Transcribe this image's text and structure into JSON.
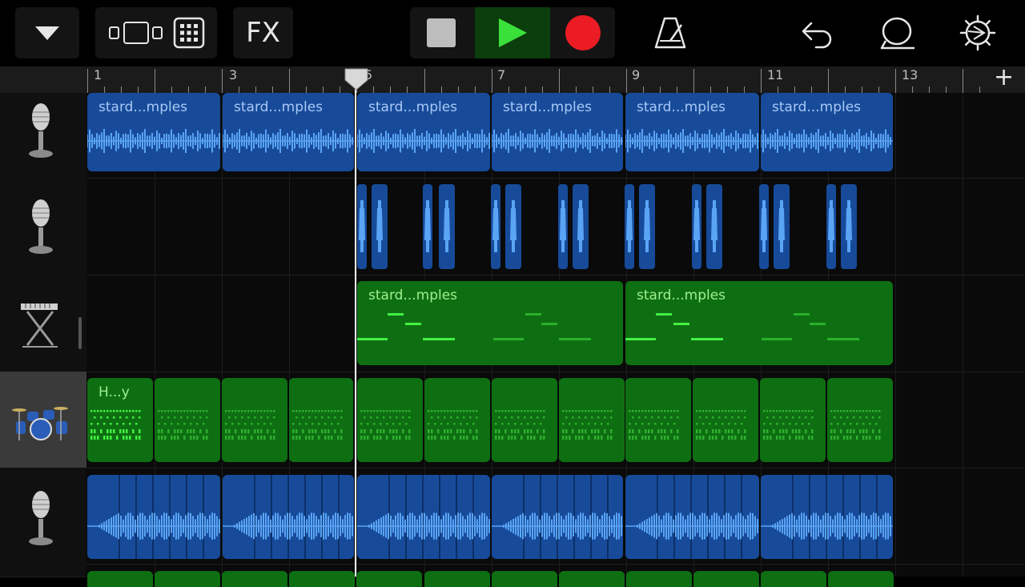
{
  "toolbar": {
    "fx_label": "FX",
    "icons": [
      "browser-dropdown-icon",
      "track-view-icon",
      "live-loops-grid-icon",
      "fx-button",
      "stop-icon",
      "play-icon",
      "record-icon",
      "metronome-icon",
      "undo-icon",
      "loop-browser-icon",
      "settings-gear-icon"
    ],
    "colors": {
      "play_bg": "#0c3d0c",
      "play": "#3ae03a",
      "record": "#ec1c24",
      "stop": "#bdbdbd"
    }
  },
  "ruler": {
    "bar_labels": [
      "1",
      "3",
      "5",
      "7",
      "9",
      "11",
      "13"
    ],
    "add_section_label": "+"
  },
  "tracks": [
    {
      "type": "audio",
      "icon": "microphone-icon",
      "selected": false
    },
    {
      "type": "audio",
      "icon": "microphone-icon",
      "selected": false
    },
    {
      "type": "keyboard",
      "icon": "keyboard-stand-icon",
      "selected": false
    },
    {
      "type": "drums",
      "icon": "drum-kit-icon",
      "selected": true
    },
    {
      "type": "audio",
      "icon": "microphone-icon",
      "selected": false
    }
  ],
  "regions": {
    "track1_name": "stard...mples",
    "track3_name": "stard...mples",
    "track4_name": "H...y"
  },
  "colors": {
    "audio_region": "#174b9a",
    "midi_region": "#0e6f12",
    "waveform": "#5aa4f5",
    "midi_note": "#43f043"
  }
}
